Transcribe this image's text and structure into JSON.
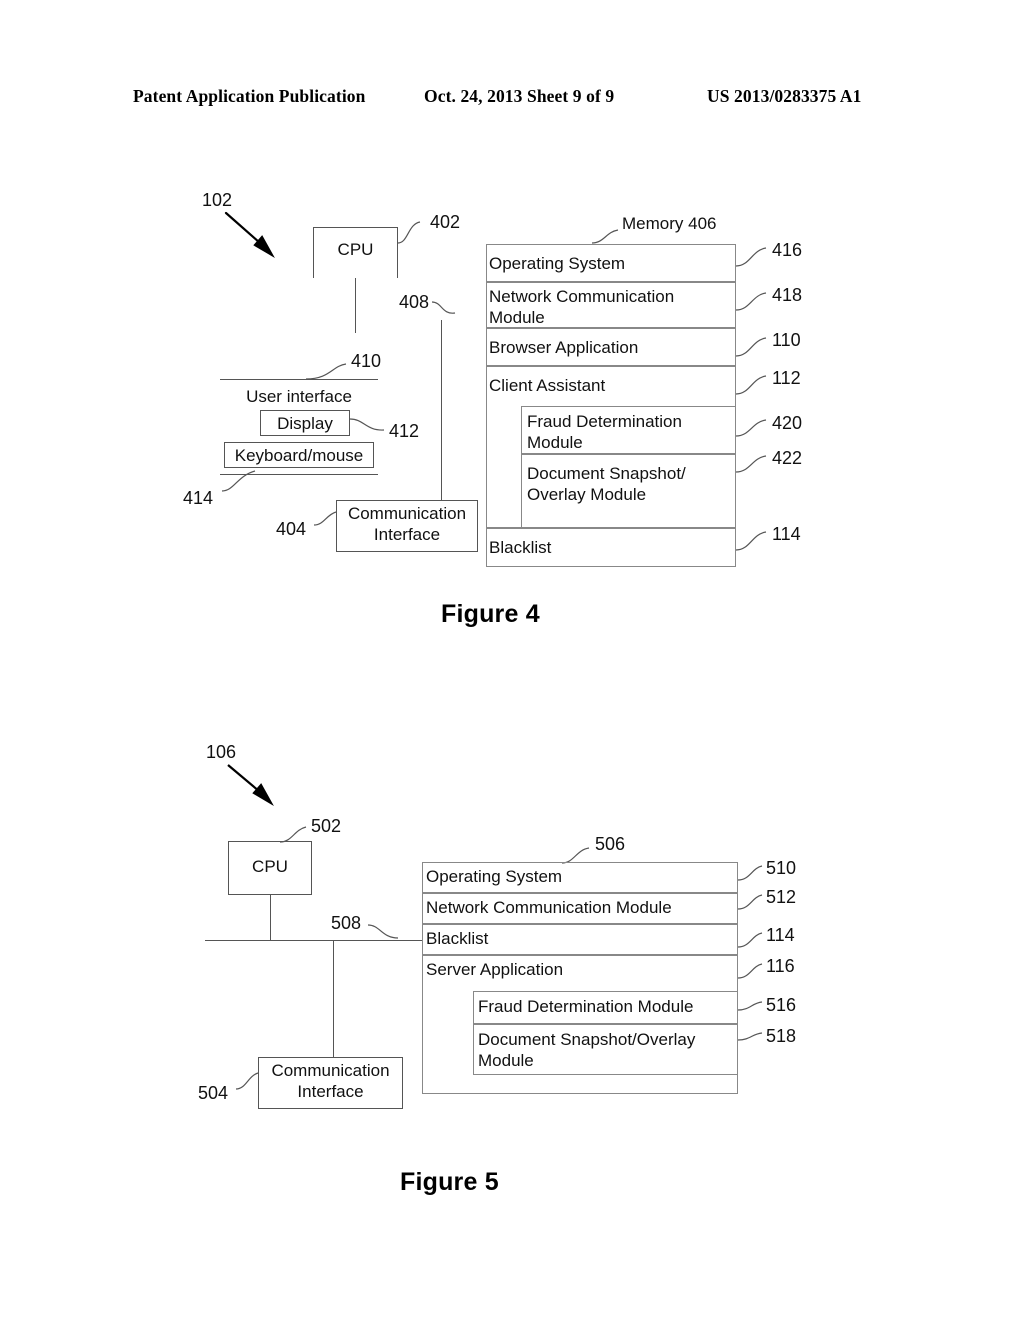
{
  "header": {
    "left": "Patent Application Publication",
    "middle": "Oct. 24, 2013  Sheet 9 of 9",
    "right": "US 2013/0283375 A1"
  },
  "figure4": {
    "caption": "Figure 4",
    "system_ref": "102",
    "cpu": {
      "label": "CPU",
      "ref": "402"
    },
    "bus_ref": "408",
    "user_interface": {
      "label": "User interface",
      "ref": "410",
      "display": {
        "label": "Display",
        "ref": "412"
      },
      "keyboard_mouse": {
        "label": "Keyboard/mouse",
        "ref": "414"
      }
    },
    "communication_interface": {
      "line1": "Communication",
      "line2": "Interface",
      "ref": "404"
    },
    "memory": {
      "title": "Memory 406",
      "ref": "406",
      "items": [
        {
          "label": "Operating System",
          "ref": "416",
          "nested": false
        },
        {
          "label": "Network Communication\nModule",
          "ref": "418",
          "nested": false
        },
        {
          "label": "Browser Application",
          "ref": "110",
          "nested": false
        },
        {
          "label": "Client Assistant",
          "ref": "112",
          "nested": false
        },
        {
          "label": "Fraud Determination\nModule",
          "ref": "420",
          "nested": true
        },
        {
          "label": "Document Snapshot/\nOverlay Module",
          "ref": "422",
          "nested": true
        },
        {
          "label": "Blacklist",
          "ref": "114",
          "nested": false
        }
      ]
    }
  },
  "figure5": {
    "caption": "Figure 5",
    "system_ref": "106",
    "cpu": {
      "label": "CPU",
      "ref": "502"
    },
    "bus_ref": "508",
    "communication_interface": {
      "line1": "Communication",
      "line2": "Interface",
      "ref": "504"
    },
    "memory": {
      "title": "506",
      "ref": "506",
      "items": [
        {
          "label": "Operating System",
          "ref": "510",
          "nested": false
        },
        {
          "label": "Network Communication Module",
          "ref": "512",
          "nested": false
        },
        {
          "label": "Blacklist",
          "ref": "114",
          "nested": false
        },
        {
          "label": "Server Application",
          "ref": "116",
          "nested": false
        },
        {
          "label": "Fraud Determination Module",
          "ref": "516",
          "nested": true
        },
        {
          "label": "Document Snapshot/Overlay\nModule",
          "ref": "518",
          "nested": true
        }
      ]
    }
  }
}
